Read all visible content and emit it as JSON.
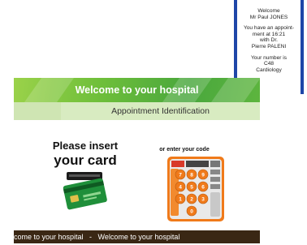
{
  "ticket": {
    "welcome": "Welcome",
    "name": "Mr Paul JONES",
    "appt_line1": "You have an appoint-",
    "appt_line2": "ment at 16:21",
    "appt_line3": "with Dr.",
    "appt_line4": "Pierre PALENI",
    "number_line": "Your number is",
    "number": "C48",
    "department": "Cardiology"
  },
  "banner": {
    "title": "Welcome to your hospital",
    "subtitle": "Appointment Identification"
  },
  "insert_card": {
    "line1": "Please insert",
    "line2": "your card"
  },
  "code_entry": {
    "label": "or enter your code",
    "keys": [
      "7",
      "8",
      "9",
      "4",
      "5",
      "6",
      "1",
      "2",
      "3",
      "0"
    ]
  },
  "ticker": {
    "text": "come to your hospital   -   Welcome to your hospital"
  },
  "colors": {
    "ticket_border": "#1f46a8",
    "banner_green": "#6fbf3a",
    "ticker_bg": "#3a2714",
    "keypad_orange": "#f07a1a"
  }
}
